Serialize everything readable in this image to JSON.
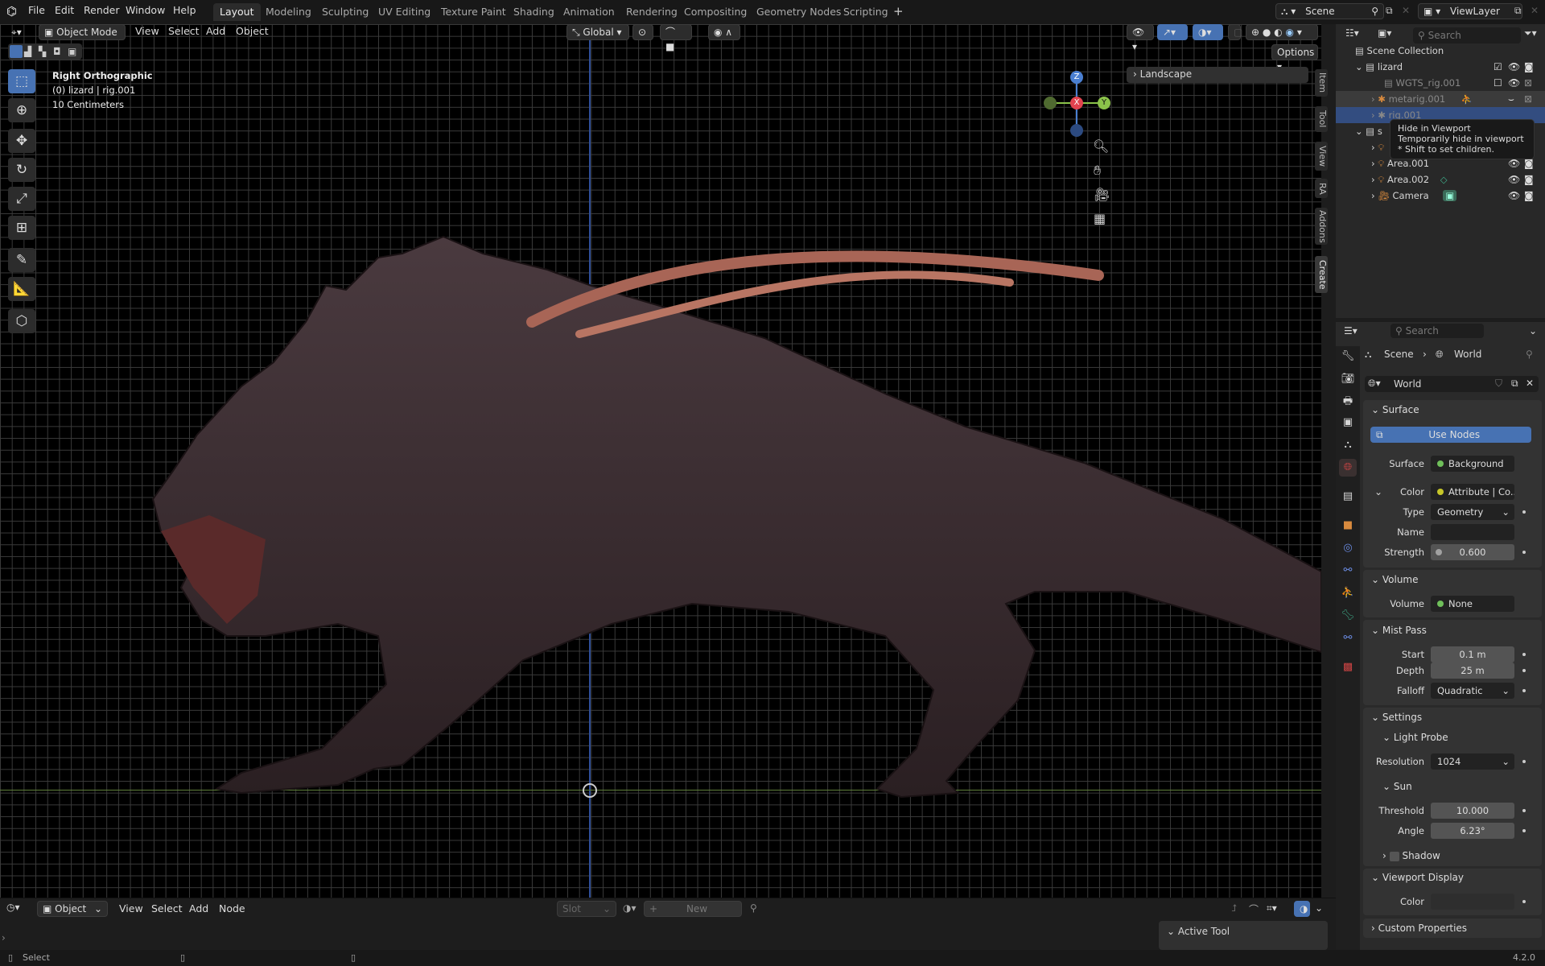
{
  "topbar": {
    "menus": [
      "File",
      "Edit",
      "Render",
      "Window",
      "Help"
    ],
    "workspaces": [
      "Layout",
      "Modeling",
      "Sculpting",
      "UV Editing",
      "Texture Paint",
      "Shading",
      "Animation",
      "Rendering",
      "Compositing",
      "Geometry Nodes",
      "Scripting"
    ],
    "add_workspace": "+",
    "scene": "Scene",
    "view_layer": "ViewLayer"
  },
  "viewport": {
    "mode": "Object Mode",
    "menus": [
      "View",
      "Select",
      "Add",
      "Object"
    ],
    "orientation": "Global",
    "view_name": "Right Orthographic",
    "object_info": "(0) lizard | rig.001",
    "scale": "10 Centimeters",
    "options": "Options",
    "landscape": "Landscape",
    "side_tabs": [
      "Item",
      "Tool",
      "View",
      "RA",
      "Addons",
      "Create"
    ],
    "gizmo": {
      "z": "Z",
      "x": "X",
      "y": "Y"
    }
  },
  "outliner": {
    "search_placeholder": "Search",
    "scene_collection": "Scene Collection",
    "rows": [
      {
        "name": "lizard"
      },
      {
        "name": "WGTS_rig.001"
      },
      {
        "name": "metarig.001"
      },
      {
        "name": "rig.001"
      },
      {
        "name": "s"
      },
      {
        "name": "Area.001"
      },
      {
        "name": "Area.002"
      },
      {
        "name": "Camera"
      }
    ],
    "tooltip": {
      "title": "Hide in Viewport",
      "desc": "Temporarily hide in viewport",
      "hint": "* Shift to set children."
    }
  },
  "properties": {
    "search_placeholder": "Search",
    "breadcrumb": [
      "Scene",
      "World"
    ],
    "datablock": "World",
    "surface": {
      "header": "Surface",
      "use_nodes": "Use Nodes",
      "surface_label": "Surface",
      "surface_value": "Background",
      "color_label": "Color",
      "color_value": "Attribute | Co...",
      "type_label": "Type",
      "type_value": "Geometry",
      "name_label": "Name",
      "name_value": "",
      "strength_label": "Strength",
      "strength_value": "0.600"
    },
    "volume": {
      "header": "Volume",
      "label": "Volume",
      "value": "None"
    },
    "mist": {
      "header": "Mist Pass",
      "start_label": "Start",
      "start": "0.1 m",
      "depth_label": "Depth",
      "depth": "25 m",
      "falloff_label": "Falloff",
      "falloff": "Quadratic"
    },
    "settings": {
      "header": "Settings",
      "light_probe": "Light Probe",
      "resolution_label": "Resolution",
      "resolution": "1024",
      "sun": "Sun",
      "threshold_label": "Threshold",
      "threshold": "10.000",
      "angle_label": "Angle",
      "angle": "6.23°",
      "shadow": "Shadow"
    },
    "viewport_display": {
      "header": "Viewport Display",
      "color_label": "Color"
    },
    "custom_properties": "Custom Properties"
  },
  "node_editor": {
    "type": "Object",
    "menus": [
      "View",
      "Select",
      "Add",
      "Node"
    ],
    "slot": "Slot",
    "new": "New",
    "active_tool": "Active Tool"
  },
  "status": {
    "select": "Select",
    "version": "4.2.0"
  },
  "colors": {
    "accent": "#4772b3",
    "x_axis": "#e2434f",
    "y_axis": "#8bc34a",
    "z_axis": "#4a7fd1",
    "creature": "#3b2c2f",
    "tentacle": "#a86556"
  }
}
